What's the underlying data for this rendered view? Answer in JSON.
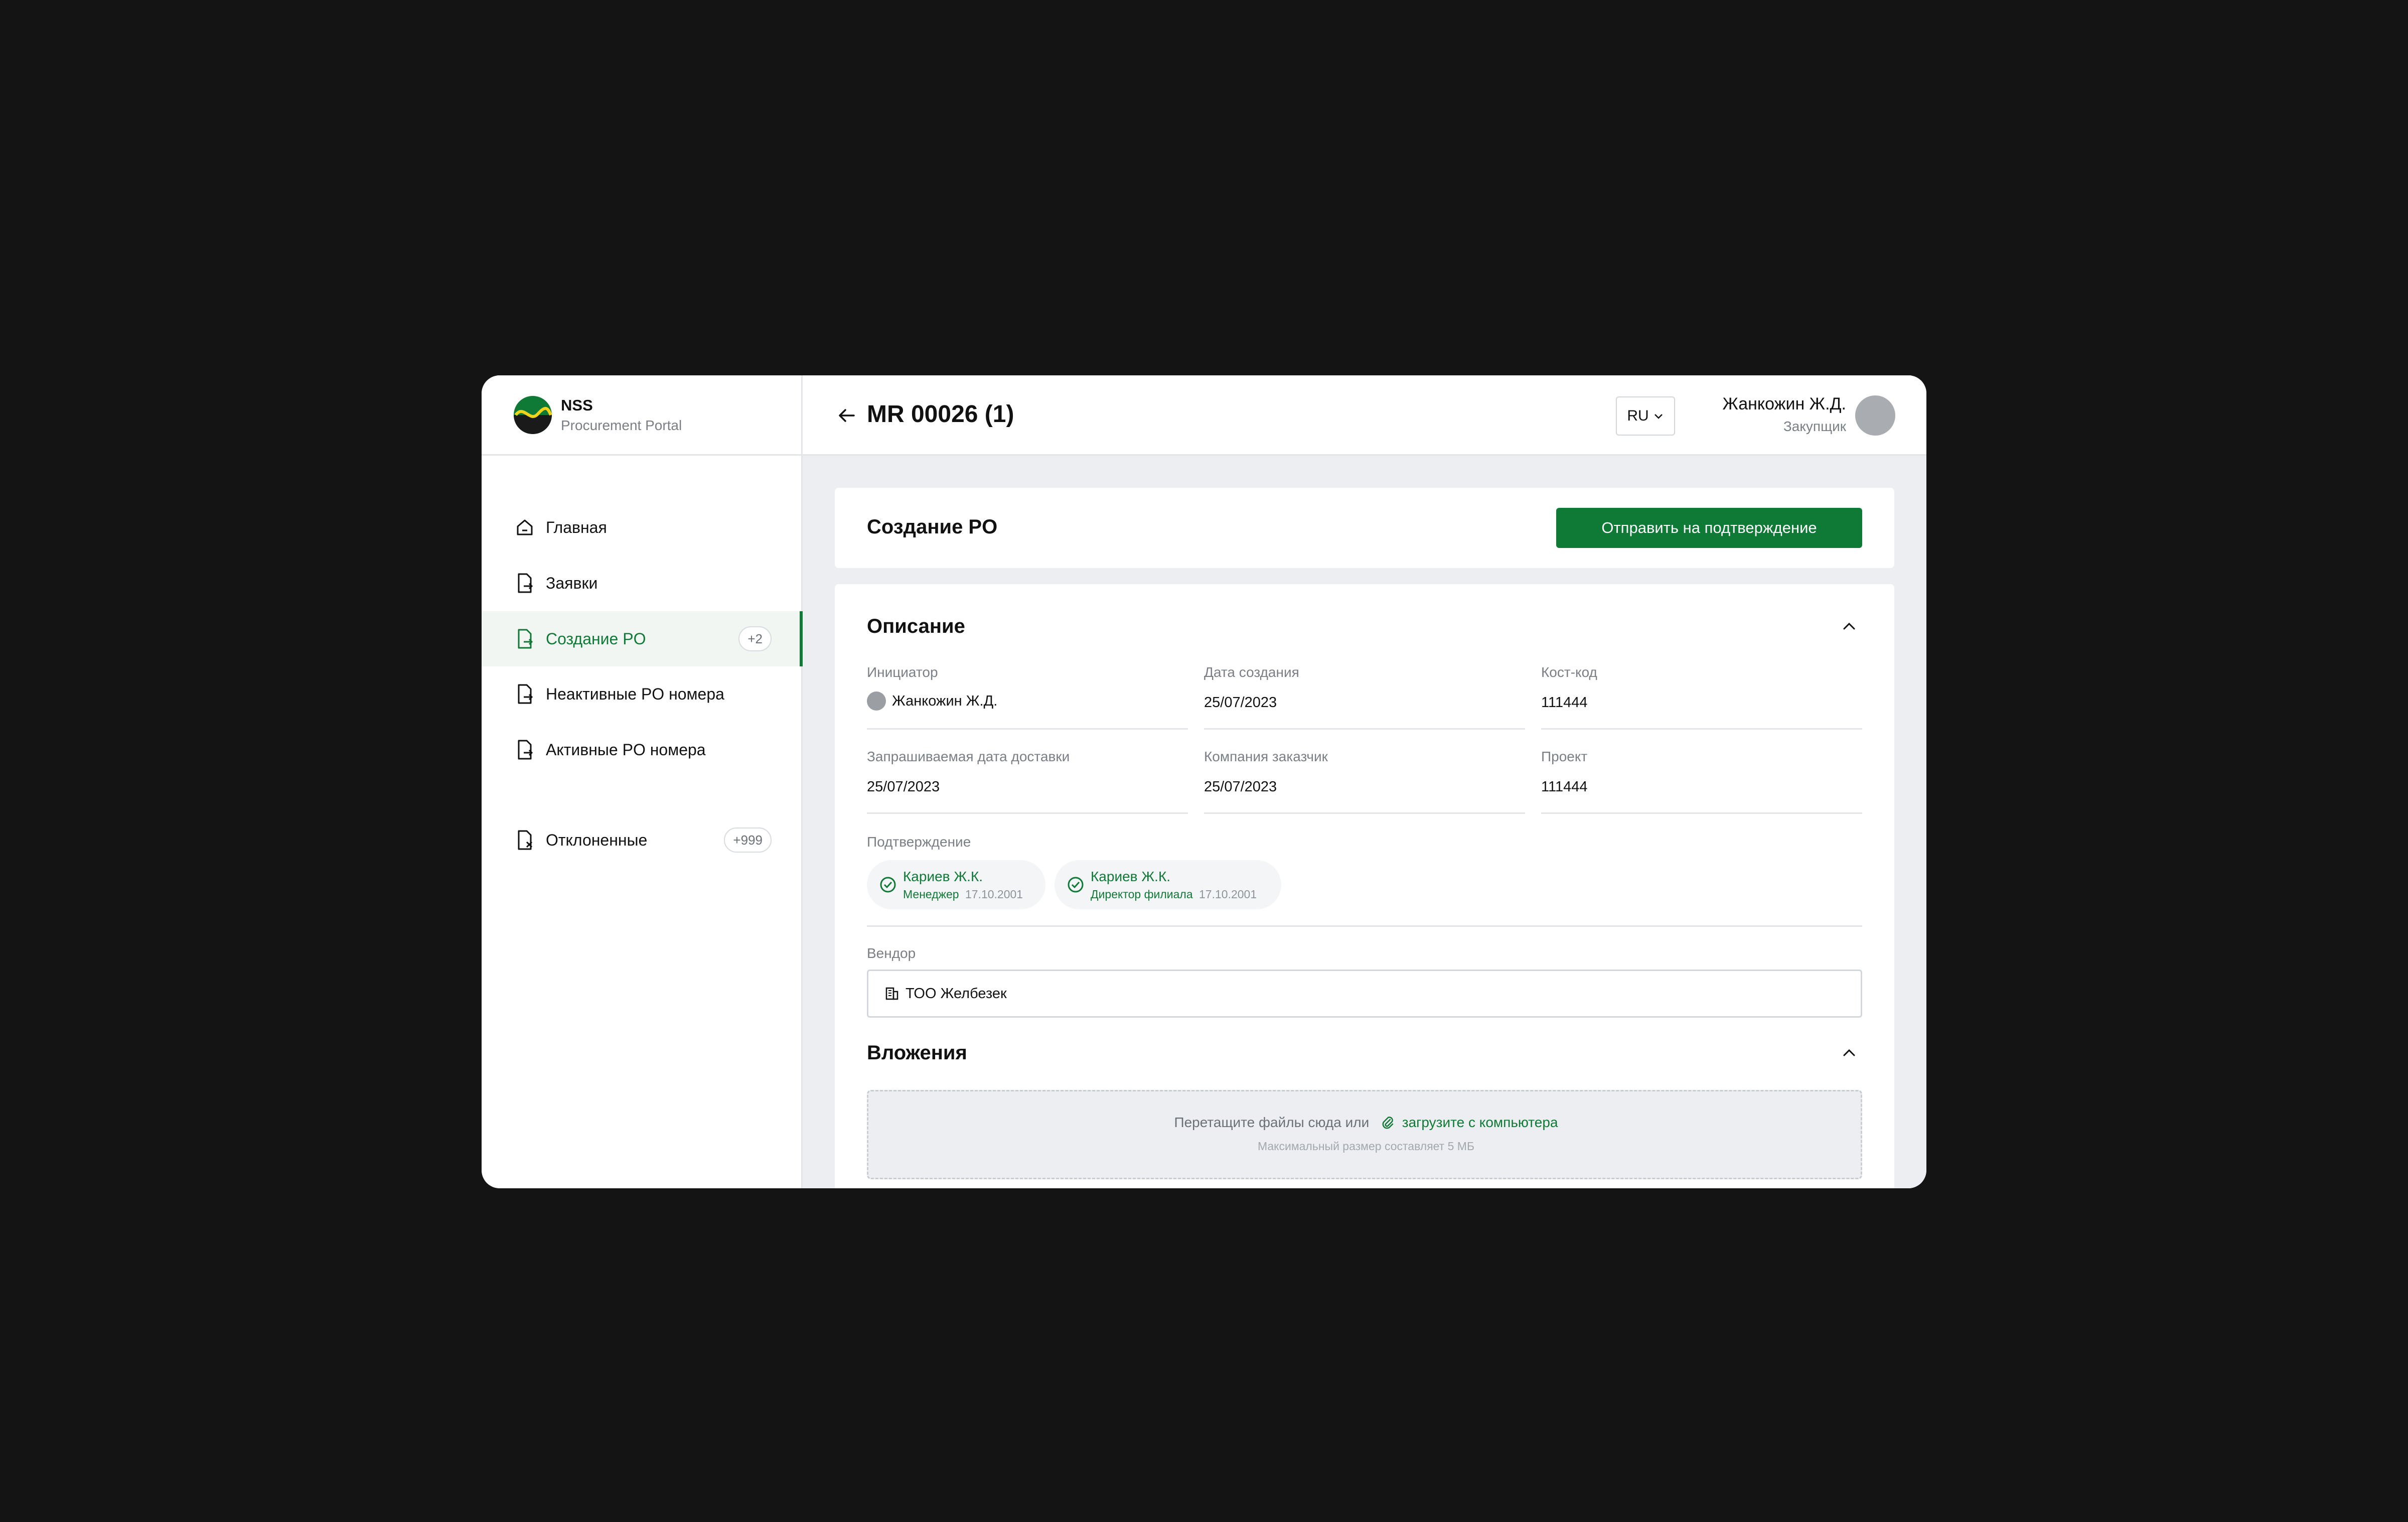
{
  "brand": {
    "title": "NSS",
    "subtitle": "Procurement Portal"
  },
  "sidebar": {
    "items": [
      {
        "label": "Главная",
        "icon": "home-icon"
      },
      {
        "label": "Заявки",
        "icon": "document-arrow-icon"
      },
      {
        "label": "Создание PO",
        "icon": "document-arrow-icon",
        "badge": "+2",
        "active": true
      },
      {
        "label": "Неактивные PO номера",
        "icon": "document-arrow-icon"
      },
      {
        "label": "Активные PO номера",
        "icon": "document-arrow-icon"
      },
      {
        "label": "Отклоненные",
        "icon": "document-x-icon",
        "badge": "+999"
      }
    ]
  },
  "header": {
    "title": "MR 00026 (1)",
    "language": "RU",
    "user_name": "Жанкожин Ж.Д.",
    "user_role": "Закупщик"
  },
  "page": {
    "card_title": "Создание PO",
    "submit_label": "Отправить на подтверждение"
  },
  "description": {
    "title": "Описание",
    "fields": [
      {
        "label": "Инициатор",
        "value": "Жанкожин Ж.Д."
      },
      {
        "label": "Дата создания",
        "value": "25/07/2023"
      },
      {
        "label": "Кост-код",
        "value": "111444"
      },
      {
        "label": "Запрашиваемая дата доставки",
        "value": "25/07/2023"
      },
      {
        "label": "Компания заказчик",
        "value": "25/07/2023"
      },
      {
        "label": "Проект",
        "value": "111444"
      }
    ],
    "approvals_label": "Подтверждение",
    "approvals": [
      {
        "name": "Кариев Ж.К.",
        "role": "Менеджер",
        "date": "17.10.2001"
      },
      {
        "name": "Кариев Ж.К.",
        "role": "Директор филиала",
        "date": "17.10.2001"
      }
    ],
    "vendor_label": "Вендор",
    "vendor_value": "ТОО Желбезек"
  },
  "attachments": {
    "title": "Вложения",
    "drop_text": "Перетащите файлы сюда или",
    "upload_link": "загрузите с компьютера",
    "max_size_note": "Максимальный размер составляет 5 МБ"
  },
  "colors": {
    "accent": "#0f7a36",
    "background": "#141414",
    "panel": "#eceef1"
  }
}
